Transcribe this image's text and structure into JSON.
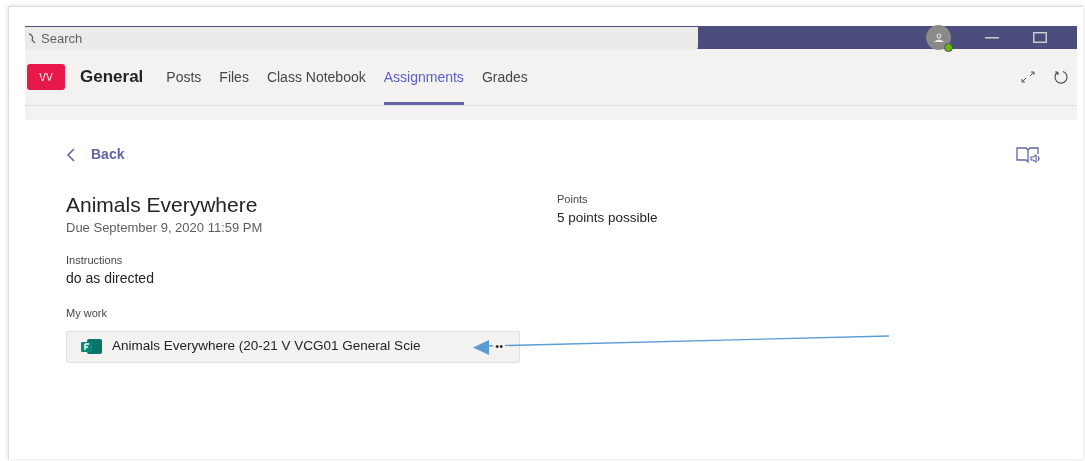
{
  "search": {
    "placeholder": "Search"
  },
  "team": {
    "initials": "VV",
    "name": "General"
  },
  "tabs": [
    {
      "label": "Posts",
      "selected": false
    },
    {
      "label": "Files",
      "selected": false
    },
    {
      "label": "Class Notebook",
      "selected": false
    },
    {
      "label": "Assignments",
      "selected": true
    },
    {
      "label": "Grades",
      "selected": false
    }
  ],
  "back": "Back",
  "assignment": {
    "title": "Animals Everywhere",
    "due": "Due September 9, 2020 11:59 PM",
    "instructions_label": "Instructions",
    "instructions": "do as directed",
    "my_work_label": "My work",
    "file": "Animals Everywhere (20-21 V VCG01 General Scie",
    "more": "••",
    "points_label": "Points",
    "points": "5 points possible"
  }
}
